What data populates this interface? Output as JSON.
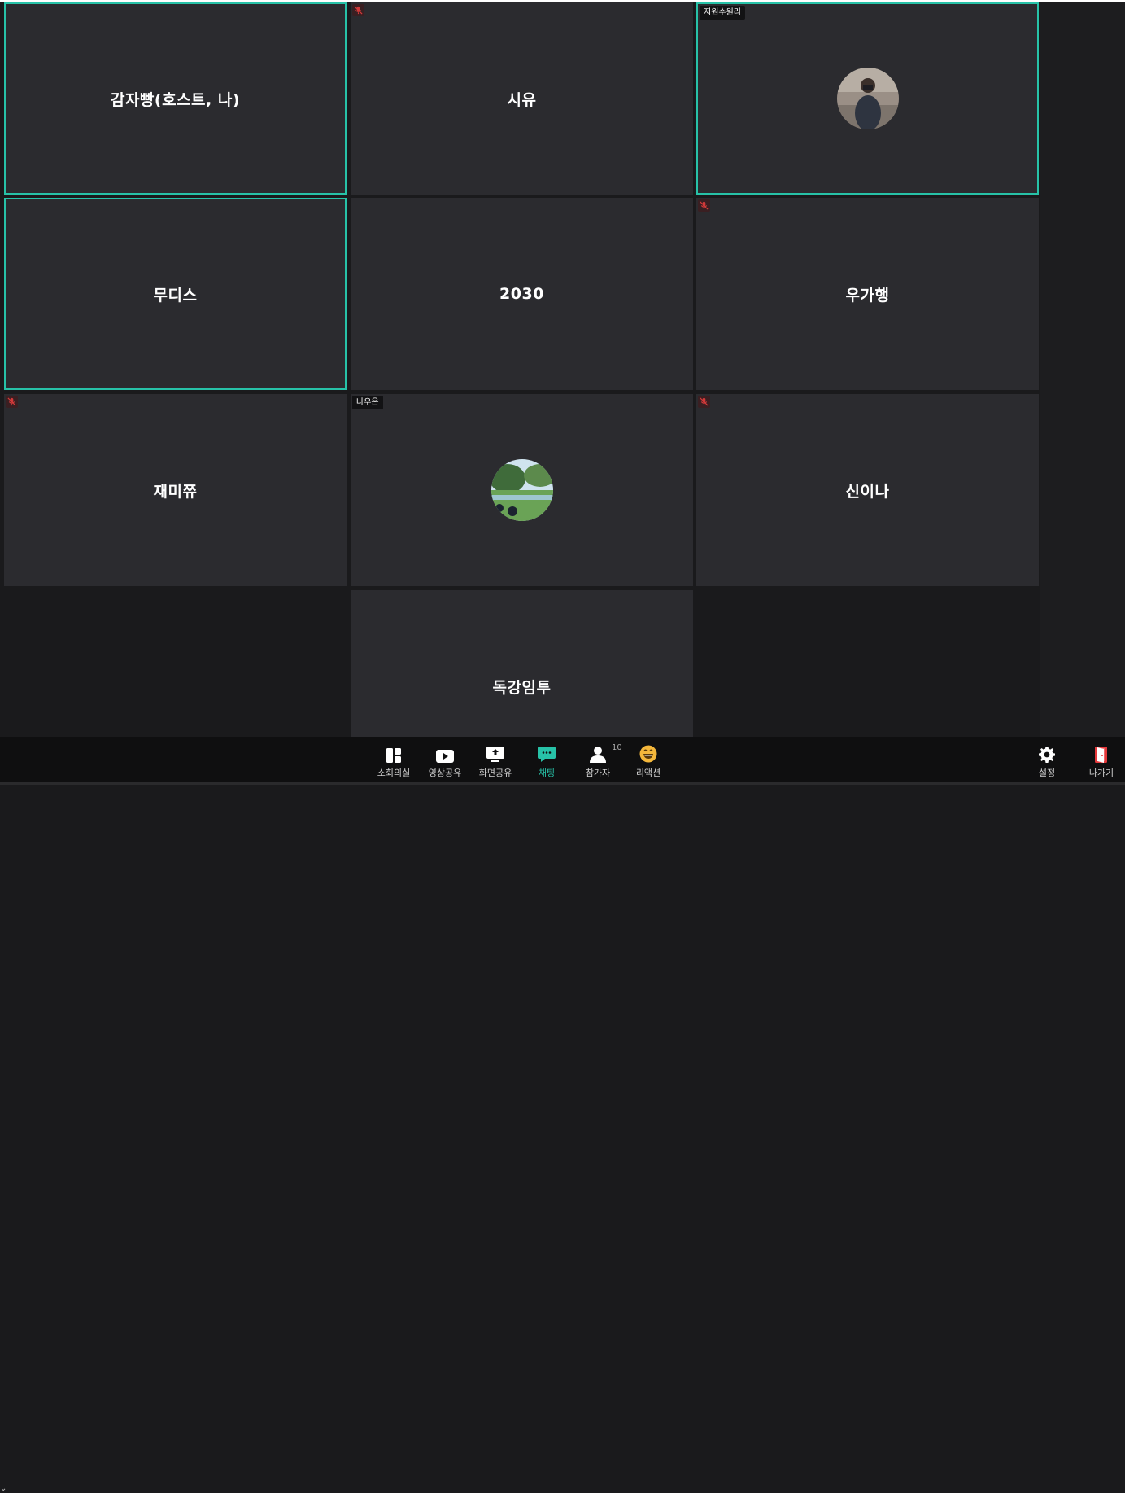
{
  "tiles": [
    {
      "name": "감자빵(호스트, 나)"
    },
    {
      "name": "시유"
    },
    {
      "label": "저원수원리"
    },
    {
      "name": "무디스"
    },
    {
      "name": "2030"
    },
    {
      "name": "우가행"
    },
    {
      "name": "재미쮸"
    },
    {
      "label": "나우온"
    },
    {
      "name": "신이나"
    },
    {
      "name": "독강임투"
    }
  ],
  "toolbar": {
    "breakout": "소회의실",
    "video_share": "영상공유",
    "screen_share": "화면공유",
    "chat": "채팅",
    "participants": "참가자",
    "participants_count": "10",
    "reactions": "리액션",
    "settings": "설정",
    "leave": "나가기"
  },
  "colors": {
    "accent": "#27c2a8",
    "tile_bg": "#2b2b2f",
    "leave_red": "#e5383b"
  }
}
